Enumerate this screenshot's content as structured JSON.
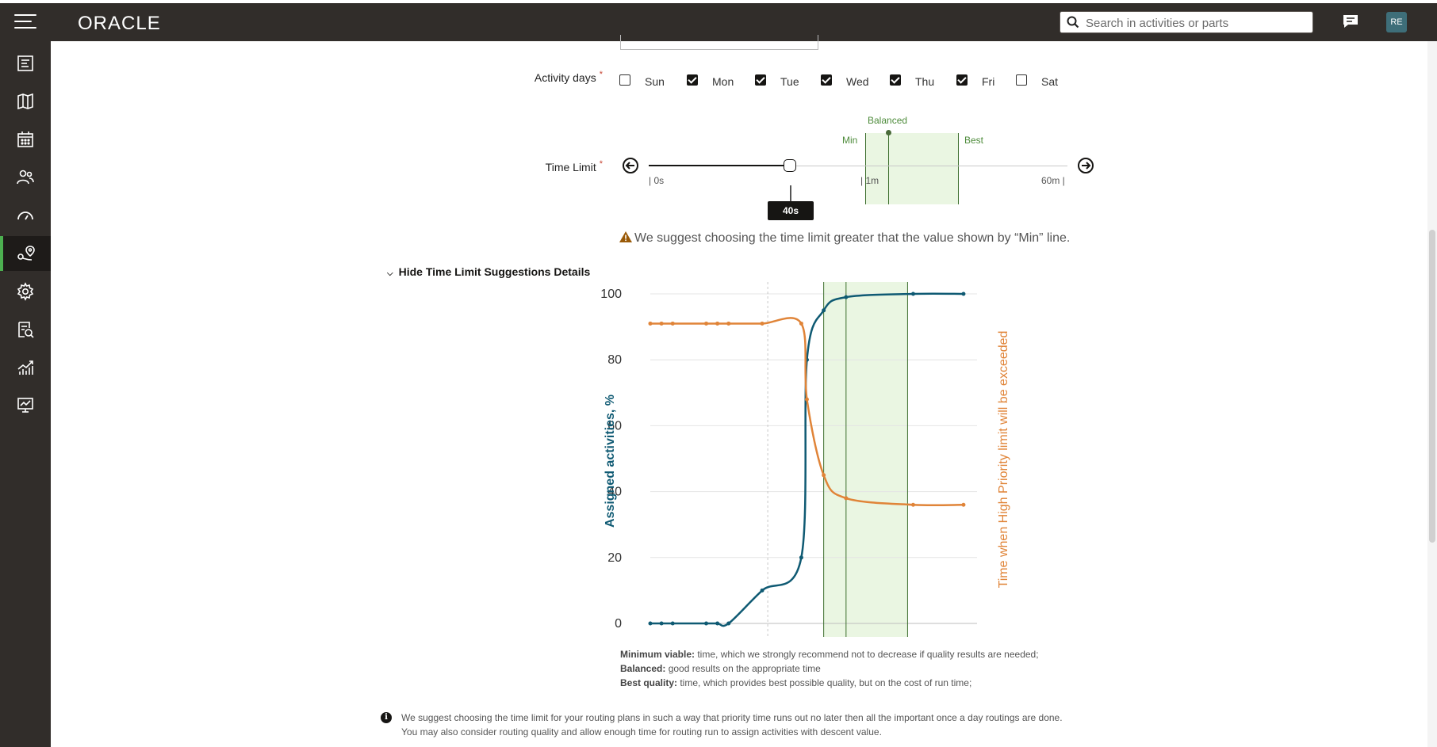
{
  "header": {
    "logo_text": "ORACLE",
    "search_placeholder": "Search in activities or parts",
    "avatar_initials": "RE"
  },
  "sidebar": {
    "items": [
      {
        "icon": "form-icon"
      },
      {
        "icon": "map-icon"
      },
      {
        "icon": "calendar-icon"
      },
      {
        "icon": "resources-icon"
      },
      {
        "icon": "dashboard-gauge-icon"
      },
      {
        "icon": "routing-icon",
        "active": true
      },
      {
        "icon": "gear-icon"
      },
      {
        "icon": "analysis-report-icon"
      },
      {
        "icon": "trend-chart-icon"
      },
      {
        "icon": "monitor-icon"
      }
    ]
  },
  "activity_days": {
    "label": "Activity days",
    "required_mark": "*",
    "days": [
      {
        "label": "Sun",
        "checked": false
      },
      {
        "label": "Mon",
        "checked": true
      },
      {
        "label": "Tue",
        "checked": true
      },
      {
        "label": "Wed",
        "checked": true
      },
      {
        "label": "Thu",
        "checked": true
      },
      {
        "label": "Fri",
        "checked": true
      },
      {
        "label": "Sat",
        "checked": false
      }
    ]
  },
  "time_limit": {
    "label": "Time Limit",
    "required_mark": "*",
    "current_value": "40s",
    "tick_start": "| 0s",
    "tick_mid": "| 1m",
    "tick_end": "60m |",
    "marker_min": "Min",
    "marker_balanced": "Balanced",
    "marker_best": "Best"
  },
  "warning_text": "We suggest choosing the time limit greater that the value shown by “Min” line.",
  "details_toggle_label": "Hide Time Limit Suggestions Details",
  "chart_data": {
    "type": "line",
    "yticks": [
      0,
      20,
      40,
      60,
      80,
      100
    ],
    "ylim": [
      0,
      100
    ],
    "ylabel": "Assigned activities, %",
    "y2label": "Time when High Priority limit will be exceeded",
    "series": [
      {
        "color": "#0f5a73",
        "x": [
          0,
          2,
          4,
          10,
          12,
          14,
          20,
          27,
          28,
          31,
          35,
          47,
          56
        ],
        "values": [
          0,
          0,
          0,
          0,
          0,
          0,
          10,
          20,
          80,
          95,
          99,
          100,
          100
        ]
      },
      {
        "color": "#e08438",
        "x": [
          0,
          2,
          4,
          10,
          12,
          14,
          20,
          27,
          28,
          31,
          35,
          47,
          56
        ],
        "values": [
          91,
          91,
          91,
          91,
          91,
          91,
          91,
          91,
          68,
          45,
          38,
          36,
          36
        ]
      }
    ],
    "min_line": 31,
    "balanced_line": 35,
    "best_line": 46,
    "current_line": 21
  },
  "notes": {
    "min_title": "Minimum viable:",
    "min_text": " time, which we strongly recommend not to decrease if quality results are needed;",
    "bal_title": "Balanced:",
    "bal_text": " good results on the appropriate time",
    "best_title": "Best quality:",
    "best_text": " time, which provides best possible quality, but on the cost of run time;"
  },
  "info": {
    "line1": "We suggest choosing the time limit for your routing plans in such a way that priority time runs out no later then all the important once a day routings are done.",
    "line2": "You may also consider routing quality and allow enough time for routing run to assign activities with descent value."
  }
}
